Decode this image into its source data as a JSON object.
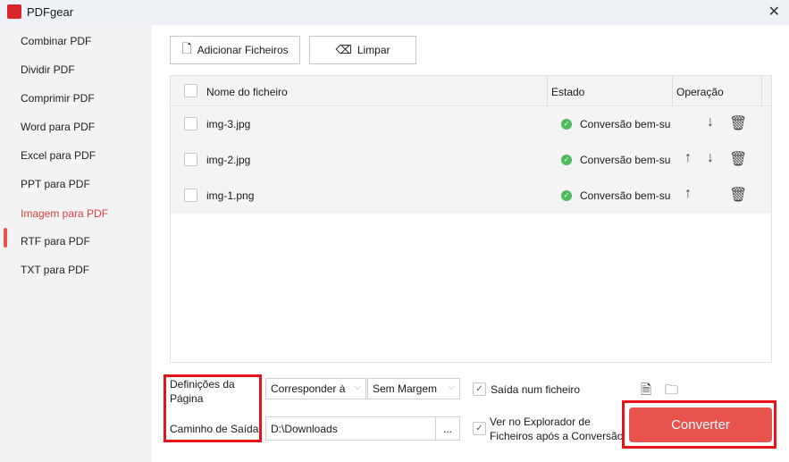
{
  "app": {
    "title": "PDFgear",
    "logo_text": "PDF"
  },
  "sidebar": {
    "items": [
      {
        "label": "Combinar PDF"
      },
      {
        "label": "Dividir PDF"
      },
      {
        "label": "Comprimir PDF"
      },
      {
        "label": "Word para PDF"
      },
      {
        "label": "Excel para PDF"
      },
      {
        "label": "PPT para PDF"
      },
      {
        "label": "Imagem para PDF",
        "active": true
      },
      {
        "label": "RTF para PDF"
      },
      {
        "label": "TXT para PDF"
      }
    ]
  },
  "toolbar": {
    "add_label": "Adicionar Ficheiros",
    "clear_label": "Limpar"
  },
  "table": {
    "headers": {
      "name": "Nome do ficheiro",
      "status": "Estado",
      "operation": "Operação"
    },
    "rows": [
      {
        "name": "img-3.jpg",
        "status": "Conversão bem-su",
        "up": false,
        "down": true
      },
      {
        "name": "img-2.jpg",
        "status": "Conversão bem-su",
        "up": true,
        "down": true
      },
      {
        "name": "img-1.png",
        "status": "Conversão bem-su",
        "up": true,
        "down": false
      }
    ]
  },
  "settings": {
    "page_label": "Definições da Página",
    "page_fit": "Corresponder à",
    "margin": "Sem Margem",
    "output_label": "Caminho de Saída",
    "output_path": "D:\\Downloads",
    "browse": "...",
    "single_file": "Saída num ficheiro",
    "single_file_checked": true,
    "open_explorer": "Ver no Explorador de Ficheiros após a Conversão",
    "open_explorer_checked": true
  },
  "convert_label": "Converter",
  "colors": {
    "accent": "#e8534e",
    "success": "#4cbb5f",
    "highlight": "#e8141a"
  }
}
